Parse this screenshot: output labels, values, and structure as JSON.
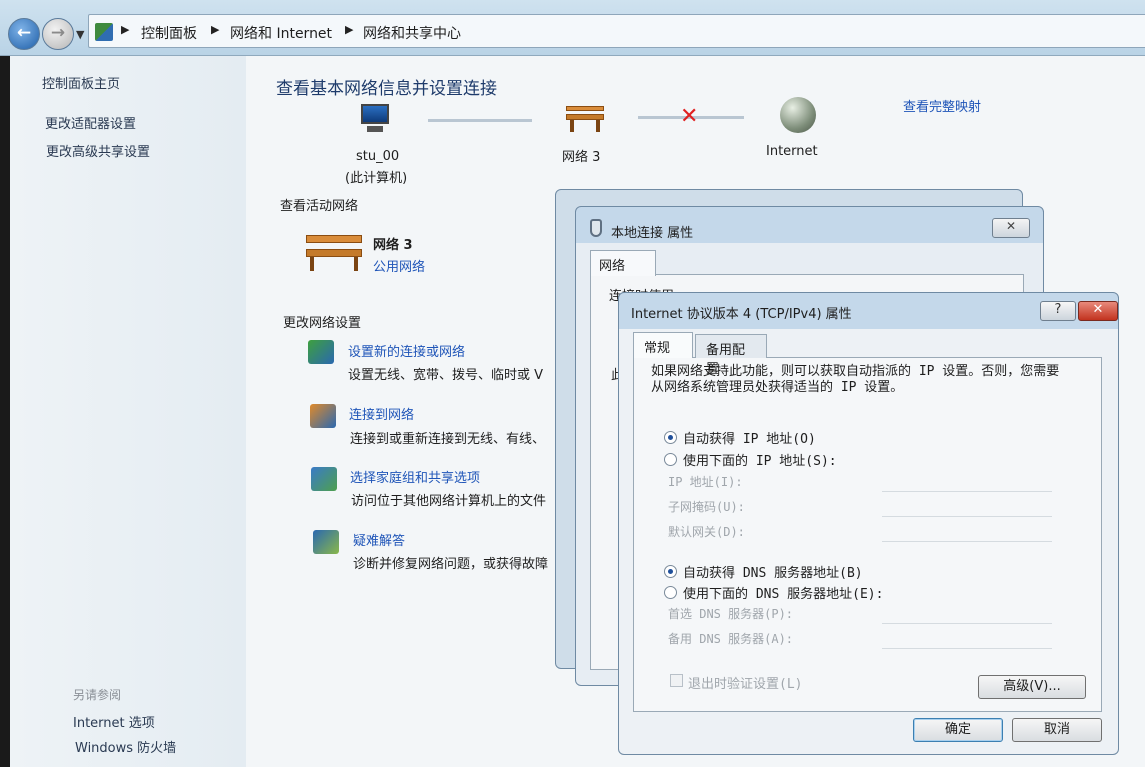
{
  "address_bar": {
    "breadcrumbs": [
      "控制面板",
      "网络和 Internet",
      "网络和共享中心"
    ]
  },
  "left_pane": {
    "home_link": "控制面板主页",
    "links": [
      "更改适配器设置",
      "更改高级共享设置"
    ],
    "see_also_label": "另请参阅",
    "see_also": [
      "Internet 选项",
      "Windows 防火墙"
    ]
  },
  "main": {
    "title": "查看基本网络信息并设置连接",
    "full_map_link": "查看完整映射",
    "map": {
      "computer_name": "stu_00",
      "computer_sub": "(此计算机)",
      "network": "网络  3",
      "internet": "Internet"
    },
    "active_networks_header": "查看活动网络",
    "active_network_name": "网络  3",
    "active_network_type": "公用网络",
    "change_settings_header": "更改网络设置",
    "tasks": [
      {
        "link": "设置新的连接或网络",
        "desc": "设置无线、宽带、拨号、临时或 V"
      },
      {
        "link": "连接到网络",
        "desc": "连接到或重新连接到无线、有线、"
      },
      {
        "link": "选择家庭组和共享选项",
        "desc": "访问位于其他网络计算机上的文件"
      },
      {
        "link": "疑难解答",
        "desc": "诊断并修复网络问题，或获得故障"
      }
    ]
  },
  "local_conn_dialog": {
    "title": "本地连接 属性",
    "tab": "网络",
    "connect_using_fragment": "连接时使用:",
    "fragment2": "此"
  },
  "ipv4_dialog": {
    "title": "Internet 协议版本 4 (TCP/IPv4) 属性",
    "help": "?",
    "close": "✕",
    "tabs": [
      "常规",
      "备用配置"
    ],
    "description": "如果网络支持此功能，则可以获取自动指派的 IP 设置。否则，您需要从网络系统管理员处获得适当的 IP 设置。",
    "ip_auto": "自动获得 IP 地址(O)",
    "ip_manual": "使用下面的 IP 地址(S):",
    "ip_fields": [
      "IP 地址(I):",
      "子网掩码(U):",
      "默认网关(D):"
    ],
    "dns_auto": "自动获得 DNS 服务器地址(B)",
    "dns_manual": "使用下面的 DNS 服务器地址(E):",
    "dns_fields": [
      "首选 DNS 服务器(P):",
      "备用 DNS 服务器(A):"
    ],
    "validate_label": "退出时验证设置(L)",
    "advanced_button": "高级(V)...",
    "ok_button": "确定",
    "cancel_button": "取消",
    "ip_auto_selected": true,
    "dns_auto_selected": true
  },
  "colors": {
    "link": "#1f55b8",
    "title": "#1e3b6b",
    "error_x": "#e02020"
  }
}
